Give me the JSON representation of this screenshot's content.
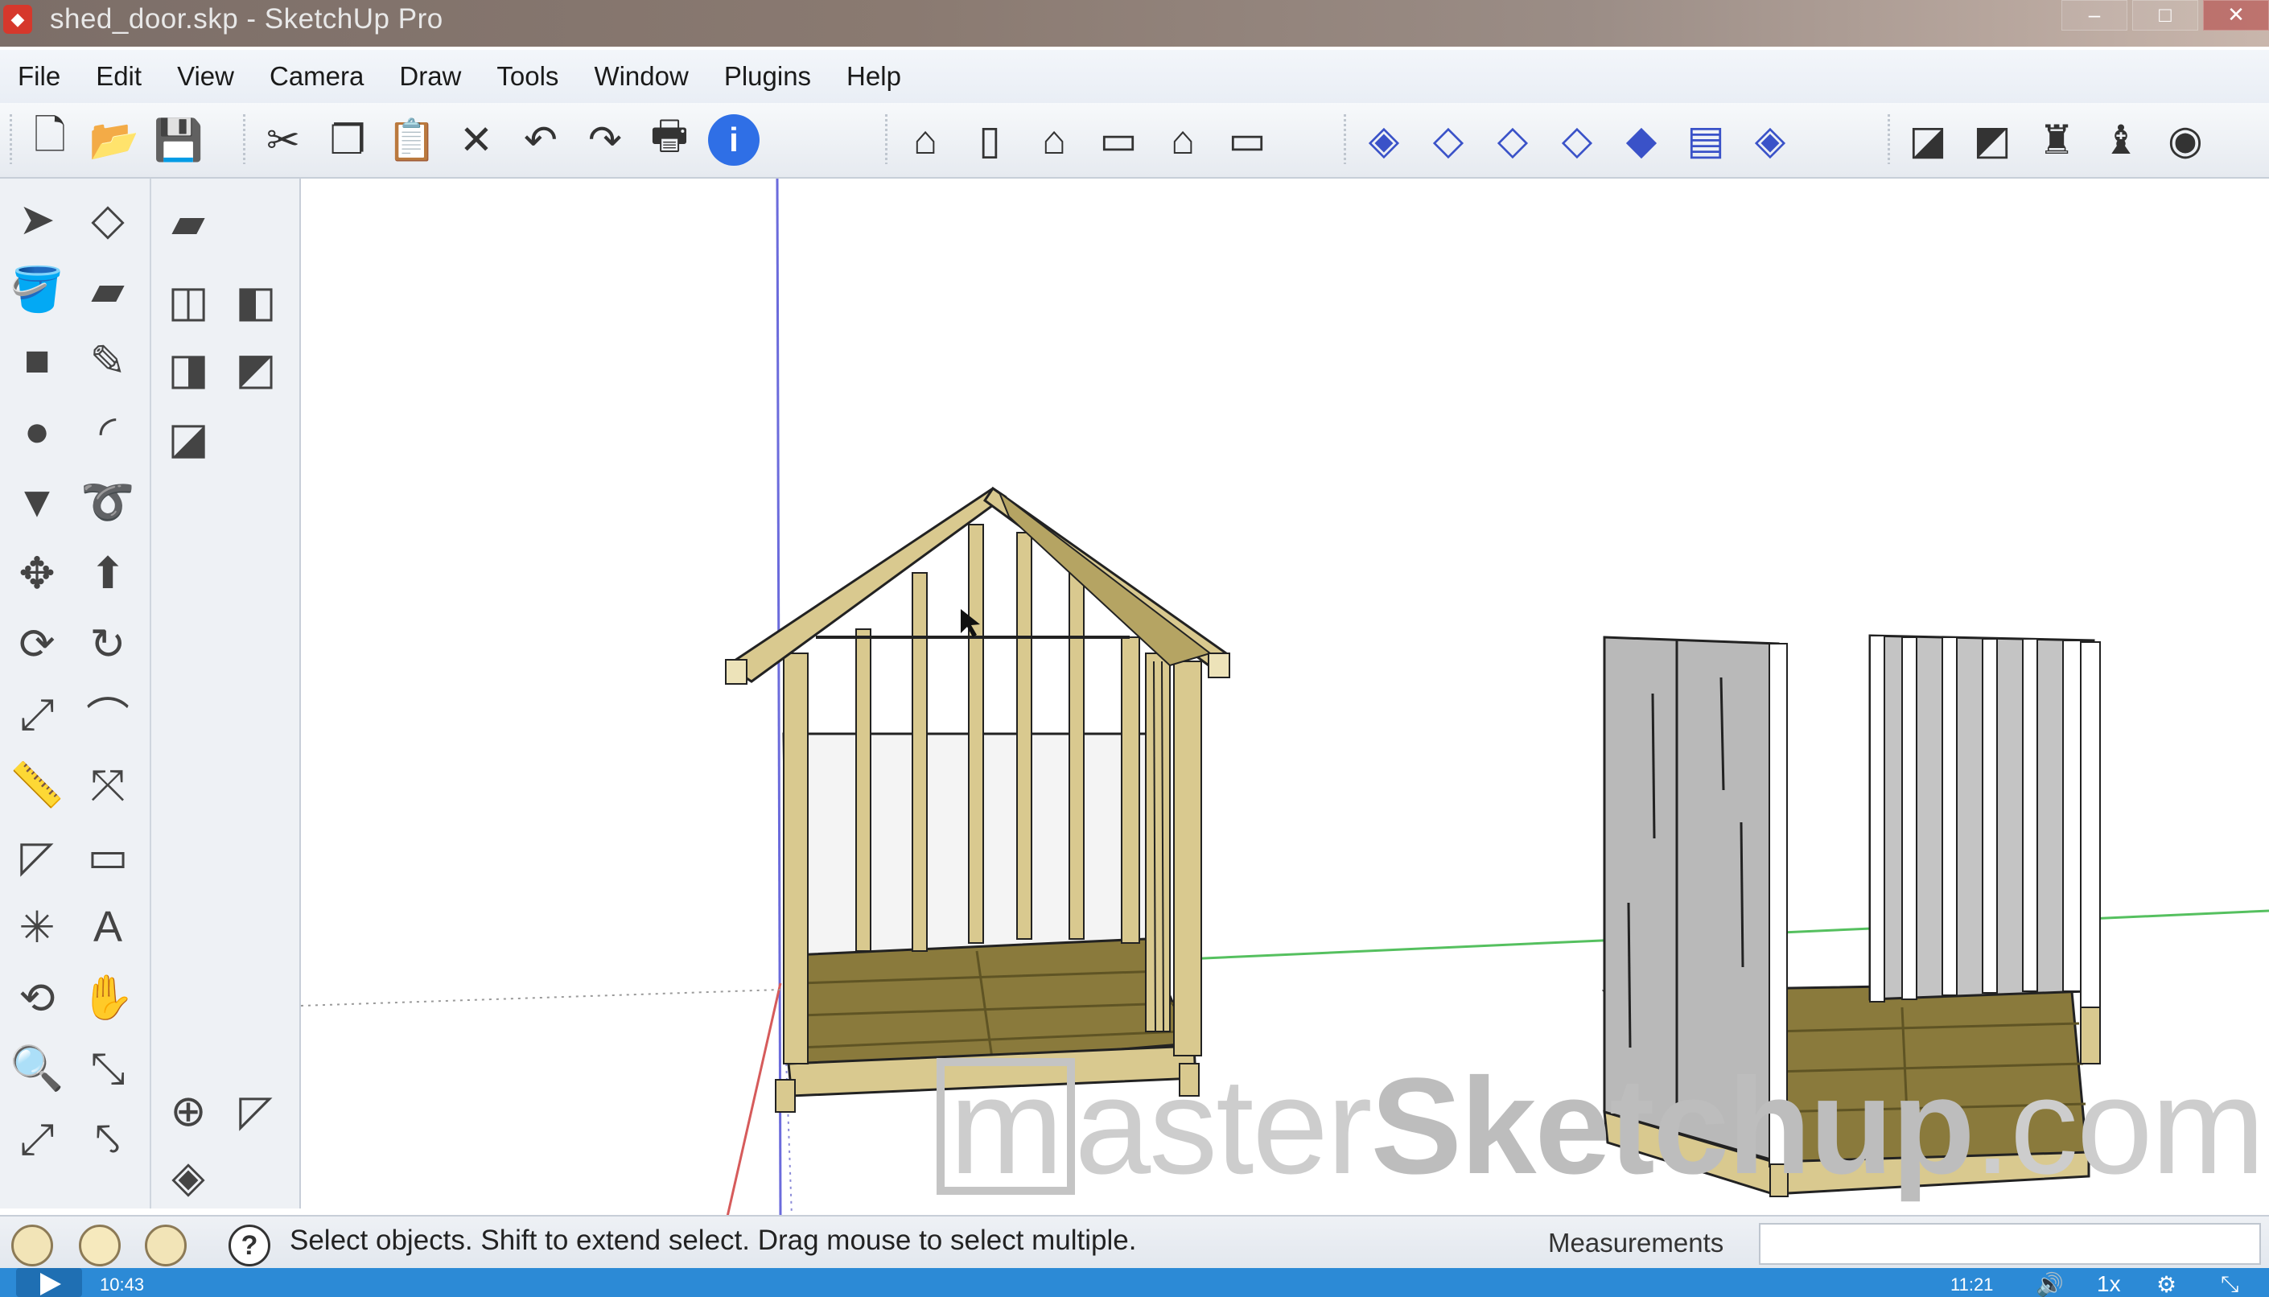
{
  "window": {
    "title": "shed_door.skp - SketchUp Pro",
    "controls": {
      "minimize": "–",
      "maximize": "□",
      "close": "✕"
    }
  },
  "menu": [
    "File",
    "Edit",
    "View",
    "Camera",
    "Draw",
    "Tools",
    "Window",
    "Plugins",
    "Help"
  ],
  "toolbar": {
    "groups": [
      {
        "items": [
          {
            "name": "new-icon",
            "glyph": "🗋"
          },
          {
            "name": "open-icon",
            "glyph": "📂"
          },
          {
            "name": "save-icon",
            "glyph": "💾"
          }
        ]
      },
      {
        "items": [
          {
            "name": "cut-icon",
            "glyph": "✂"
          },
          {
            "name": "copy-icon",
            "glyph": "❐"
          },
          {
            "name": "paste-icon",
            "glyph": "📋"
          },
          {
            "name": "erase-icon",
            "glyph": "✕"
          },
          {
            "name": "undo-icon",
            "glyph": "↶"
          },
          {
            "name": "redo-icon",
            "glyph": "↷"
          },
          {
            "name": "print-icon",
            "glyph": "🖶"
          },
          {
            "name": "model-info-icon",
            "glyph": "i"
          }
        ]
      },
      {
        "items": [
          {
            "name": "iso-view-icon",
            "glyph": "⌂"
          },
          {
            "name": "top-view-icon",
            "glyph": "▯"
          },
          {
            "name": "front-view-icon",
            "glyph": "⌂"
          },
          {
            "name": "right-view-icon",
            "glyph": "▭"
          },
          {
            "name": "back-view-icon",
            "glyph": "⌂"
          },
          {
            "name": "left-view-icon",
            "glyph": "▭"
          }
        ]
      },
      {
        "items": [
          {
            "name": "xray-icon",
            "glyph": "◈"
          },
          {
            "name": "wireframe-icon",
            "glyph": "◇"
          },
          {
            "name": "hidden-line-icon",
            "glyph": "◇"
          },
          {
            "name": "shaded-icon",
            "glyph": "◇"
          },
          {
            "name": "shaded-textures-icon",
            "glyph": "◆"
          },
          {
            "name": "monochrome-icon",
            "glyph": "▤"
          },
          {
            "name": "display-mode-icon",
            "glyph": "◈"
          }
        ]
      },
      {
        "items": [
          {
            "name": "get-models-icon",
            "glyph": "◪"
          },
          {
            "name": "share-model-icon",
            "glyph": "◩"
          },
          {
            "name": "extension-warehouse-icon",
            "glyph": "♜"
          },
          {
            "name": "share-component-icon",
            "glyph": "♝"
          },
          {
            "name": "google-earth-icon",
            "glyph": "◉"
          }
        ]
      }
    ]
  },
  "left_tools": [
    {
      "name": "select-tool-icon",
      "glyph": "➤"
    },
    {
      "name": "make-component-icon",
      "glyph": "◇"
    },
    {
      "name": "paint-bucket-icon",
      "glyph": "🪣"
    },
    {
      "name": "eraser-tool-icon",
      "glyph": "▰"
    },
    {
      "name": "rectangle-tool-icon",
      "glyph": "■"
    },
    {
      "name": "line-tool-icon",
      "glyph": "✎"
    },
    {
      "name": "circle-tool-icon",
      "glyph": "●"
    },
    {
      "name": "arc-tool-icon",
      "glyph": "◜"
    },
    {
      "name": "polygon-tool-icon",
      "glyph": "▼"
    },
    {
      "name": "freehand-tool-icon",
      "glyph": "➰"
    },
    {
      "name": "move-tool-icon",
      "glyph": "✥"
    },
    {
      "name": "push-pull-tool-icon",
      "glyph": "⬆"
    },
    {
      "name": "rotate-tool-icon",
      "glyph": "⟳"
    },
    {
      "name": "follow-me-tool-icon",
      "glyph": "↻"
    },
    {
      "name": "scale-tool-icon",
      "glyph": "⤢"
    },
    {
      "name": "offset-tool-icon",
      "glyph": "⌒"
    },
    {
      "name": "tape-measure-tool-icon",
      "glyph": "📏"
    },
    {
      "name": "dimension-tool-icon",
      "glyph": "⤧"
    },
    {
      "name": "protractor-tool-icon",
      "glyph": "◸"
    },
    {
      "name": "text-tool-icon",
      "glyph": "▭"
    },
    {
      "name": "axes-tool-icon",
      "glyph": "✳"
    },
    {
      "name": "3d-text-tool-icon",
      "glyph": "A"
    },
    {
      "name": "orbit-tool-icon",
      "glyph": "⟲"
    },
    {
      "name": "pan-tool-icon",
      "glyph": "✋"
    },
    {
      "name": "zoom-tool-icon",
      "glyph": "🔍"
    },
    {
      "name": "zoom-window-tool-icon",
      "glyph": "⤡"
    },
    {
      "name": "zoom-extents-tool-icon",
      "glyph": "⤢"
    },
    {
      "name": "previous-view-icon",
      "glyph": "⤣"
    }
  ],
  "section_tools": [
    {
      "name": "outer-shell-icon",
      "glyph": "▰"
    },
    {
      "name": "intersect-icon",
      "glyph": "◫"
    },
    {
      "name": "union-icon",
      "glyph": "◧"
    },
    {
      "name": "subtract-icon",
      "glyph": "◨"
    },
    {
      "name": "trim-icon",
      "glyph": "◩"
    },
    {
      "name": "split-icon",
      "glyph": "◪"
    },
    {
      "name": "position-camera-icon",
      "glyph": "⊕"
    },
    {
      "name": "walk-tool-icon",
      "glyph": "◸"
    },
    {
      "name": "look-around-icon",
      "glyph": "◈"
    }
  ],
  "status": {
    "text": "Select objects. Shift to extend select. Drag mouse to select multiple.",
    "measurements_label": "Measurements",
    "measurements_value": ""
  },
  "video": {
    "time": "10:43",
    "duration": "11:21",
    "speed": "1x"
  },
  "watermark": {
    "m": "m",
    "light": "aster",
    "bold": "Sketchup",
    "tail": ".com"
  },
  "colors": {
    "wood": "#d9c98f",
    "wood_dark": "#8a7a3c",
    "wall": "#b9b9b9",
    "axis_green": "#3cb043",
    "axis_blue": "#3b3bd6",
    "axis_red": "#d63b3b",
    "video_bar": "#2c8ad6"
  }
}
